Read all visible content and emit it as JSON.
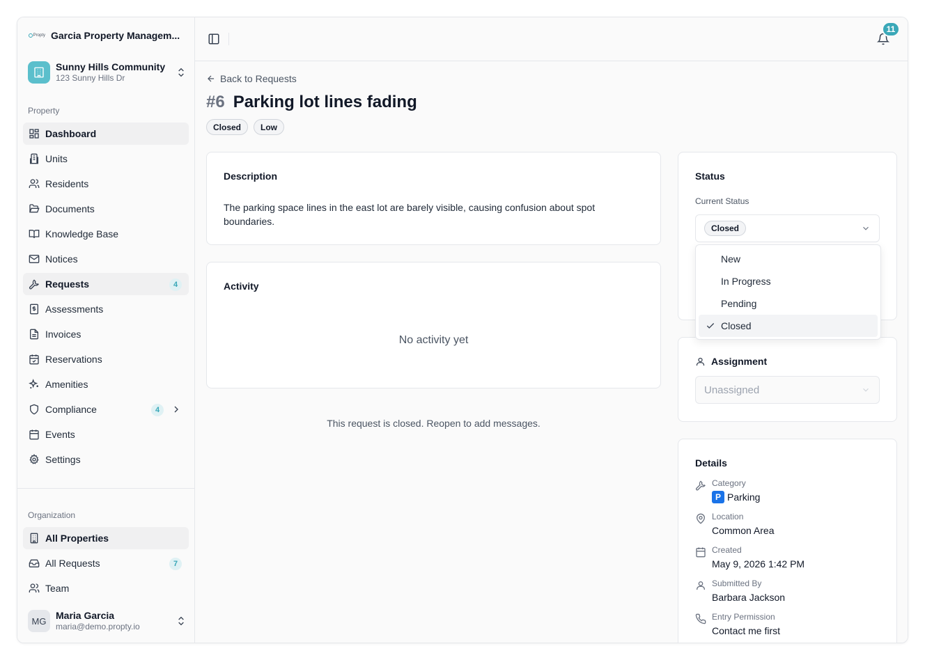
{
  "org": {
    "name": "Garcia Property Managem...",
    "logo_text": "Propty"
  },
  "property": {
    "name": "Sunny Hills Community",
    "address": "123 Sunny Hills Dr"
  },
  "sidebar": {
    "property_label": "Property",
    "items": [
      {
        "label": "Dashboard"
      },
      {
        "label": "Units"
      },
      {
        "label": "Residents"
      },
      {
        "label": "Documents"
      },
      {
        "label": "Knowledge Base"
      },
      {
        "label": "Notices"
      },
      {
        "label": "Requests",
        "badge": "4"
      },
      {
        "label": "Assessments"
      },
      {
        "label": "Invoices"
      },
      {
        "label": "Reservations"
      },
      {
        "label": "Amenities"
      },
      {
        "label": "Compliance",
        "badge": "4"
      },
      {
        "label": "Events"
      },
      {
        "label": "Settings"
      }
    ],
    "org_label": "Organization",
    "org_items": [
      {
        "label": "All Properties"
      },
      {
        "label": "All Requests",
        "badge": "7"
      },
      {
        "label": "Team"
      }
    ]
  },
  "user": {
    "initials": "MG",
    "name": "Maria Garcia",
    "email": "maria@demo.propty.io"
  },
  "topbar": {
    "notification_count": "11"
  },
  "request": {
    "back_label": "Back to Requests",
    "number": "#6",
    "title": "Parking lot lines fading",
    "status_pill": "Closed",
    "priority_pill": "Low",
    "description_title": "Description",
    "description": "The parking space lines in the east lot are barely visible, causing confusion about spot boundaries.",
    "activity_title": "Activity",
    "activity_empty": "No activity yet",
    "closed_note": "This request is closed. Reopen to add messages."
  },
  "status_card": {
    "title": "Status",
    "current_label": "Current Status",
    "current_value": "Closed",
    "options": [
      "New",
      "In Progress",
      "Pending",
      "Closed"
    ],
    "selected": "Closed"
  },
  "assignment": {
    "title": "Assignment",
    "value": "Unassigned"
  },
  "details": {
    "title": "Details",
    "category_label": "Category",
    "category_value": "Parking",
    "category_icon_text": "P",
    "location_label": "Location",
    "location_value": "Common Area",
    "created_label": "Created",
    "created_value": "May 9, 2026 1:42 PM",
    "submitted_label": "Submitted By",
    "submitted_value": "Barbara Jackson",
    "entry_label": "Entry Permission",
    "entry_value": "Contact me first"
  },
  "colors": {
    "accent": "#3aa8b8",
    "accent_light": "#dff1f4"
  }
}
